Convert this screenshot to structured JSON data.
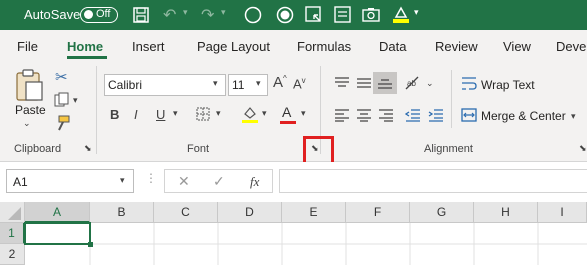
{
  "titlebar": {
    "autosave_label": "AutoSave",
    "toggle_state": "Off"
  },
  "tabs": [
    {
      "label": "File"
    },
    {
      "label": "Home"
    },
    {
      "label": "Insert"
    },
    {
      "label": "Page Layout"
    },
    {
      "label": "Formulas"
    },
    {
      "label": "Data"
    },
    {
      "label": "Review"
    },
    {
      "label": "View"
    },
    {
      "label": "Deve"
    }
  ],
  "ribbon": {
    "clipboard": {
      "paste_label": "Paste",
      "group_label": "Clipboard"
    },
    "font": {
      "font_name": "Calibri",
      "font_size": "11",
      "bold": "B",
      "italic": "I",
      "underline": "U",
      "group_label": "Font"
    },
    "alignment": {
      "wrap_text": "Wrap Text",
      "merge_center": "Merge & Center",
      "group_label": "Alignment"
    }
  },
  "formula_bar": {
    "name_box": "A1",
    "fx": "fx"
  },
  "sheet": {
    "columns": [
      "A",
      "B",
      "C",
      "D",
      "E",
      "F",
      "G",
      "H",
      "I"
    ],
    "rows": [
      "1",
      "2"
    ]
  }
}
